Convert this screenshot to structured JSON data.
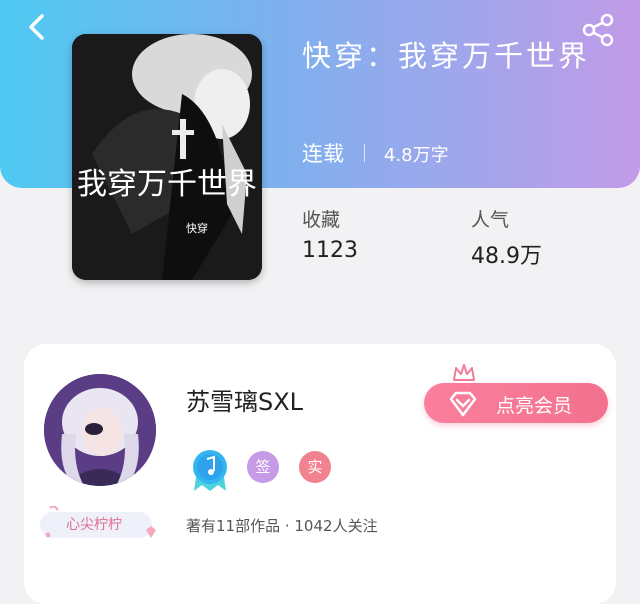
{
  "book": {
    "title": "快穿：我穿万千世界",
    "cover_text": "我穿万千世界",
    "cover_small": "快穿",
    "status": "连载",
    "word_count": "4.8万字"
  },
  "stats": {
    "favorites_label": "收藏",
    "favorites_value": "1123",
    "popularity_label": "人气",
    "popularity_value": "48.9万"
  },
  "author": {
    "name": "苏雪璃SXL",
    "tag": "心尖柠柠",
    "vip_label": "点亮会员",
    "badges": [
      "签",
      "实"
    ],
    "works_info": "著有11部作品 · 1042人关注"
  },
  "icons": {
    "back": "chevron-left-icon",
    "share": "share-icon",
    "vip": "diamond-icon",
    "crown": "crown-icon"
  },
  "colors": {
    "header_start": "#4fc9f2",
    "header_end": "#c29be8",
    "vip": "#f2728e",
    "badge_sign": "#c69ae6",
    "badge_real": "#f2828f"
  }
}
